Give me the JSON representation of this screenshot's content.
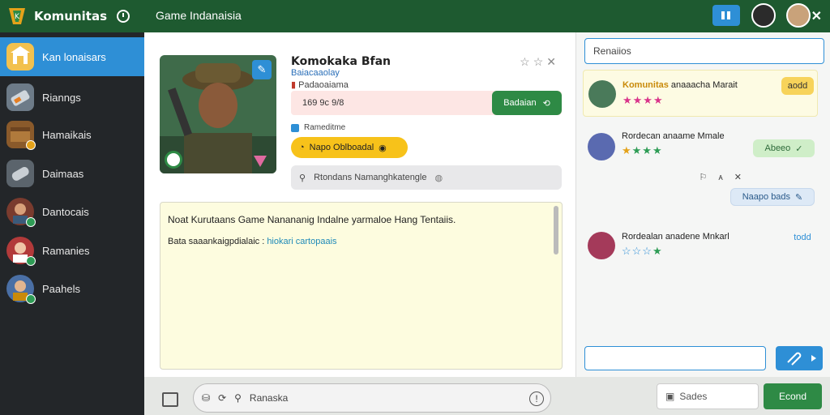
{
  "app": {
    "title": "Komunitas",
    "window_title": "Game Indanaisia"
  },
  "sidebar": {
    "items": [
      {
        "label": "Kan lonaisars",
        "icon": "home-icon",
        "active": true
      },
      {
        "label": "Rianngs",
        "icon": "tag-icon",
        "active": false
      },
      {
        "label": "Hamaikais",
        "icon": "box-icon",
        "active": false
      },
      {
        "label": "Daimaas",
        "icon": "cylinder-icon",
        "active": false
      },
      {
        "label": "Dantocais",
        "icon": "char-icon",
        "active": false
      },
      {
        "label": "Ramanies",
        "icon": "char-icon",
        "active": false
      },
      {
        "label": "Paahels",
        "icon": "char-icon",
        "active": false
      }
    ]
  },
  "profile": {
    "name": "Komokaka Bfan",
    "subtitle": "Baiacaaolay",
    "role": "Padaoaiama",
    "field_value": "169 9c 9/8",
    "action_button": "Badaian",
    "status_label": "Rameditme",
    "pill_label": "Napo Oblboadal",
    "search_placeholder": "Rtondans Namanghkatengle"
  },
  "notes": {
    "line1": "Noat Kurutaans Game Nanananig Indalne yarmaloe Hang Tentaiis.",
    "line2_prefix": "Bata saaankaigpdialaic :",
    "line2_link": "hiokari cartopaais"
  },
  "bottom": {
    "search_text": "Ranaska",
    "field_text": "Sades",
    "send_label": "Econd"
  },
  "right_panel": {
    "search_value": "Renaiios",
    "items": [
      {
        "title": "Komunitas",
        "title_rest": "anaaacha Marait",
        "stars": 4,
        "tag": "aodd"
      },
      {
        "title": "",
        "title_rest": "Rordecan anaame Mmale",
        "stars": 4,
        "tag": "Abeeo"
      },
      {
        "title": "",
        "title_rest": "",
        "stars": 0,
        "tag": "Naapo bads"
      },
      {
        "title": "",
        "title_rest": "Rordealan anadene Mnkarl",
        "stars": 3,
        "tag": "todd"
      }
    ]
  },
  "colors": {
    "brand_green": "#1e5a30",
    "accent_blue": "#2e8fd6",
    "accent_yellow": "#f7c21a",
    "action_green": "#2e8a45"
  }
}
